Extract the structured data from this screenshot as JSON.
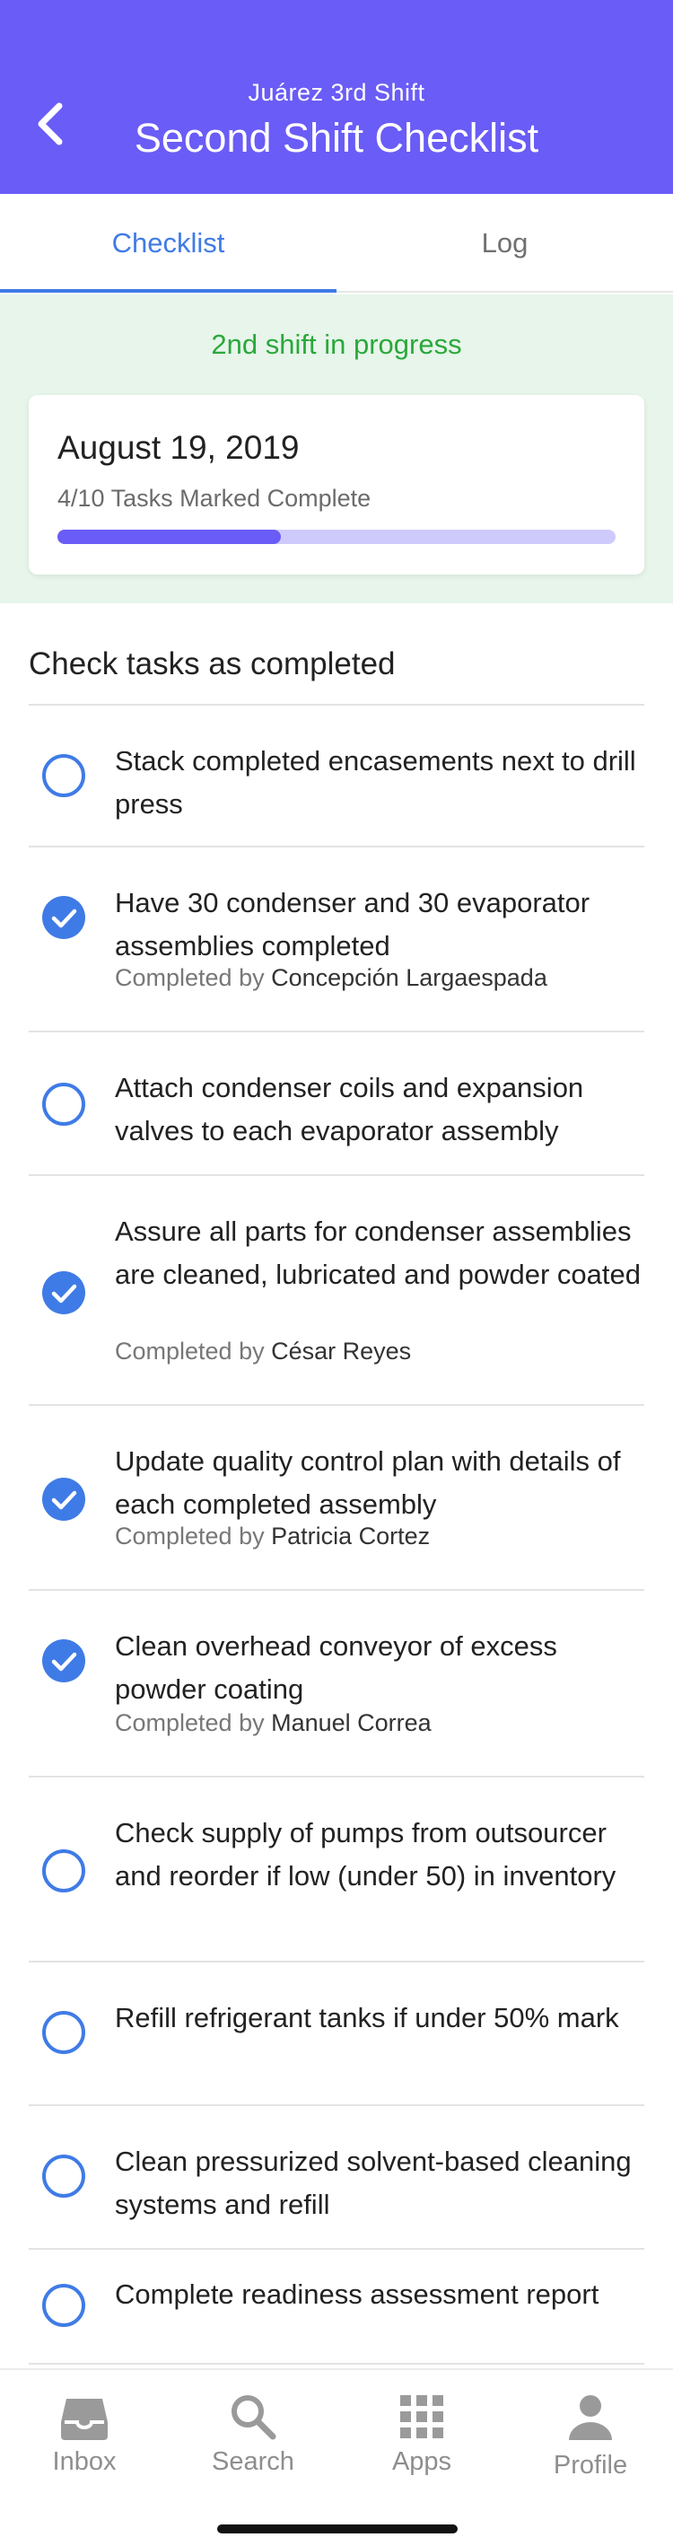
{
  "header": {
    "subtitle": "Juárez 3rd Shift",
    "title": "Second Shift Checklist",
    "back_icon": "chevron-left-icon"
  },
  "tabs": [
    {
      "label": "Checklist",
      "active": true
    },
    {
      "label": "Log",
      "active": false
    }
  ],
  "status": {
    "text": "2nd shift in progress",
    "color": "#2aa83b"
  },
  "progress_card": {
    "date": "August 19, 2019",
    "count_text": "4/10 Tasks Marked Complete",
    "fraction_complete": 0.4
  },
  "checklist": {
    "title": "Check tasks as completed",
    "completed_prefix": "Completed by",
    "items": [
      {
        "text": "Stack completed encasements next to drill press",
        "checked": false,
        "completed_by": ""
      },
      {
        "text": "Have 30 condenser and 30 evaporator assemblies completed",
        "checked": true,
        "completed_by": "Concepción Largaespada"
      },
      {
        "text": "Attach condenser coils and expansion valves to each evaporator assembly",
        "checked": false,
        "completed_by": ""
      },
      {
        "text": "Assure all parts for condenser assemblies are cleaned, lubricated and powder coated",
        "checked": true,
        "completed_by": "César Reyes"
      },
      {
        "text": "Update quality control plan with details of each completed assembly",
        "checked": true,
        "completed_by": "Patricia Cortez"
      },
      {
        "text": "Clean overhead conveyor of excess powder coating",
        "checked": true,
        "completed_by": "Manuel Correa"
      },
      {
        "text": "Check supply of pumps from outsourcer and reorder if low (under 50) in inventory",
        "checked": false,
        "completed_by": ""
      },
      {
        "text": "Refill refrigerant tanks if under 50% mark",
        "checked": false,
        "completed_by": ""
      },
      {
        "text": "Clean pressurized solvent-based cleaning systems and refill",
        "checked": false,
        "completed_by": ""
      },
      {
        "text": "Complete readiness assessment report",
        "checked": false,
        "completed_by": ""
      }
    ]
  },
  "bottom_nav": [
    {
      "label": "Inbox",
      "icon": "inbox-icon"
    },
    {
      "label": "Search",
      "icon": "search-icon"
    },
    {
      "label": "Apps",
      "icon": "apps-grid-icon"
    },
    {
      "label": "Profile",
      "icon": "profile-icon"
    }
  ],
  "colors": {
    "brand": "#6a5cf6",
    "accent": "#3f7be6",
    "progress_track": "#cfcafc",
    "status_bg": "#e7f5ea"
  }
}
